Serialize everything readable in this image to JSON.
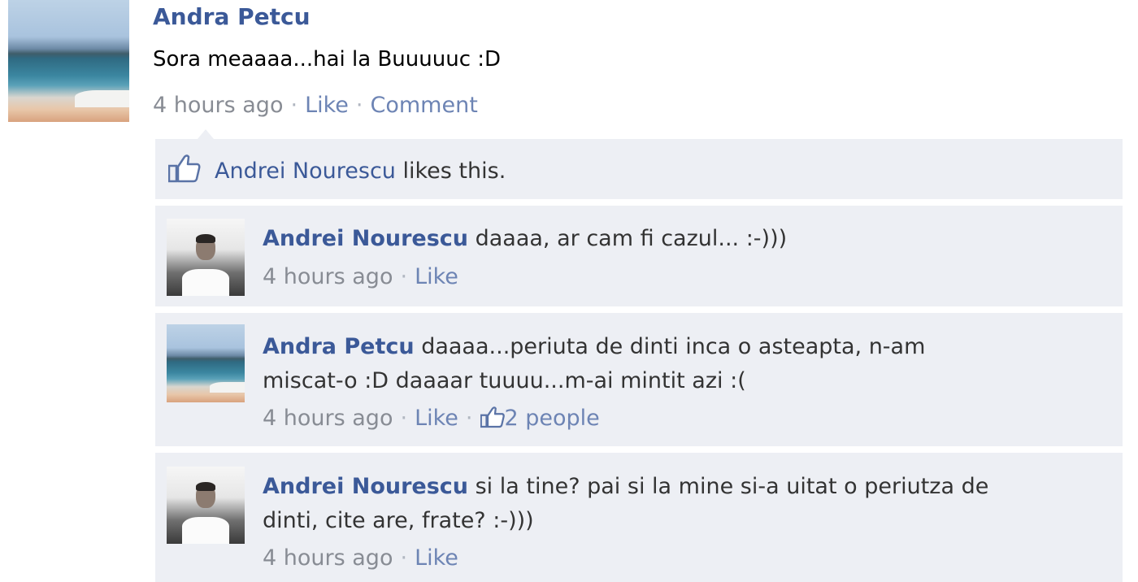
{
  "post": {
    "author": "Andra Petcu",
    "text": "Sora meaaaa...hai la Buuuuuc :D",
    "time": "4 hours ago",
    "like_label": "Like",
    "comment_label": "Comment"
  },
  "likes": {
    "liker": "Andrei Nourescu",
    "suffix": " likes this."
  },
  "comments": [
    {
      "author": "Andrei Nourescu",
      "text": " daaaa, ar cam fi cazul... :-)))",
      "time": "4 hours ago",
      "like_label": "Like"
    },
    {
      "author": "Andra Petcu",
      "text": " daaaa...periuta de dinti inca o asteapta, n-am miscat-o :D daaaar tuuuu...m-ai mintit azi :(",
      "time": "4 hours ago",
      "like_label": "Like",
      "people_likes": "2 people"
    },
    {
      "author": "Andrei Nourescu",
      "text": " si la tine? pai si la mine si-a uitat o periutza de dinti, cite are, frate? :-)))",
      "time": "4 hours ago",
      "like_label": "Like"
    }
  ],
  "icons": {
    "thumbs_up": "thumbs-up-icon"
  },
  "colors": {
    "link_blue": "#3b5998",
    "panel_bg": "#edeff4",
    "meta_gray": "#888c94"
  }
}
